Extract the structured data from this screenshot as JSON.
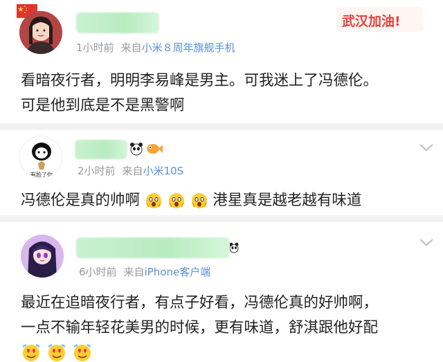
{
  "posts": [
    {
      "time": "1小时前",
      "from_prefix": "来自",
      "source": "小米８周年旗舰手机",
      "text_lines": [
        "看暗夜行者，明明李易峰是男主。可我迷上了冯德伦。",
        "可是他到底是不是黑警啊"
      ]
    },
    {
      "time": "2小时前",
      "from_prefix": "来自",
      "source": "小米10S",
      "text_a": "冯德伦是真的帅啊",
      "text_b": "港星真是越老越有味道",
      "avatar_text": "有脸了你"
    },
    {
      "time": "6小时前",
      "from_prefix": "来自",
      "source": "iPhone客户端",
      "text_lines": [
        "最近在追暗夜行者，有点子好看，冯德伦真的好帅啊，",
        "一点不输年轻花美男的时候，更有味道，舒淇跟他好配"
      ]
    }
  ],
  "badge": {
    "text": "武汉加油!"
  },
  "colors": {
    "source_link": "#5a8fd9",
    "meta": "#999999",
    "name_blur": "#b8ebc0",
    "badge": "#e8413d"
  }
}
